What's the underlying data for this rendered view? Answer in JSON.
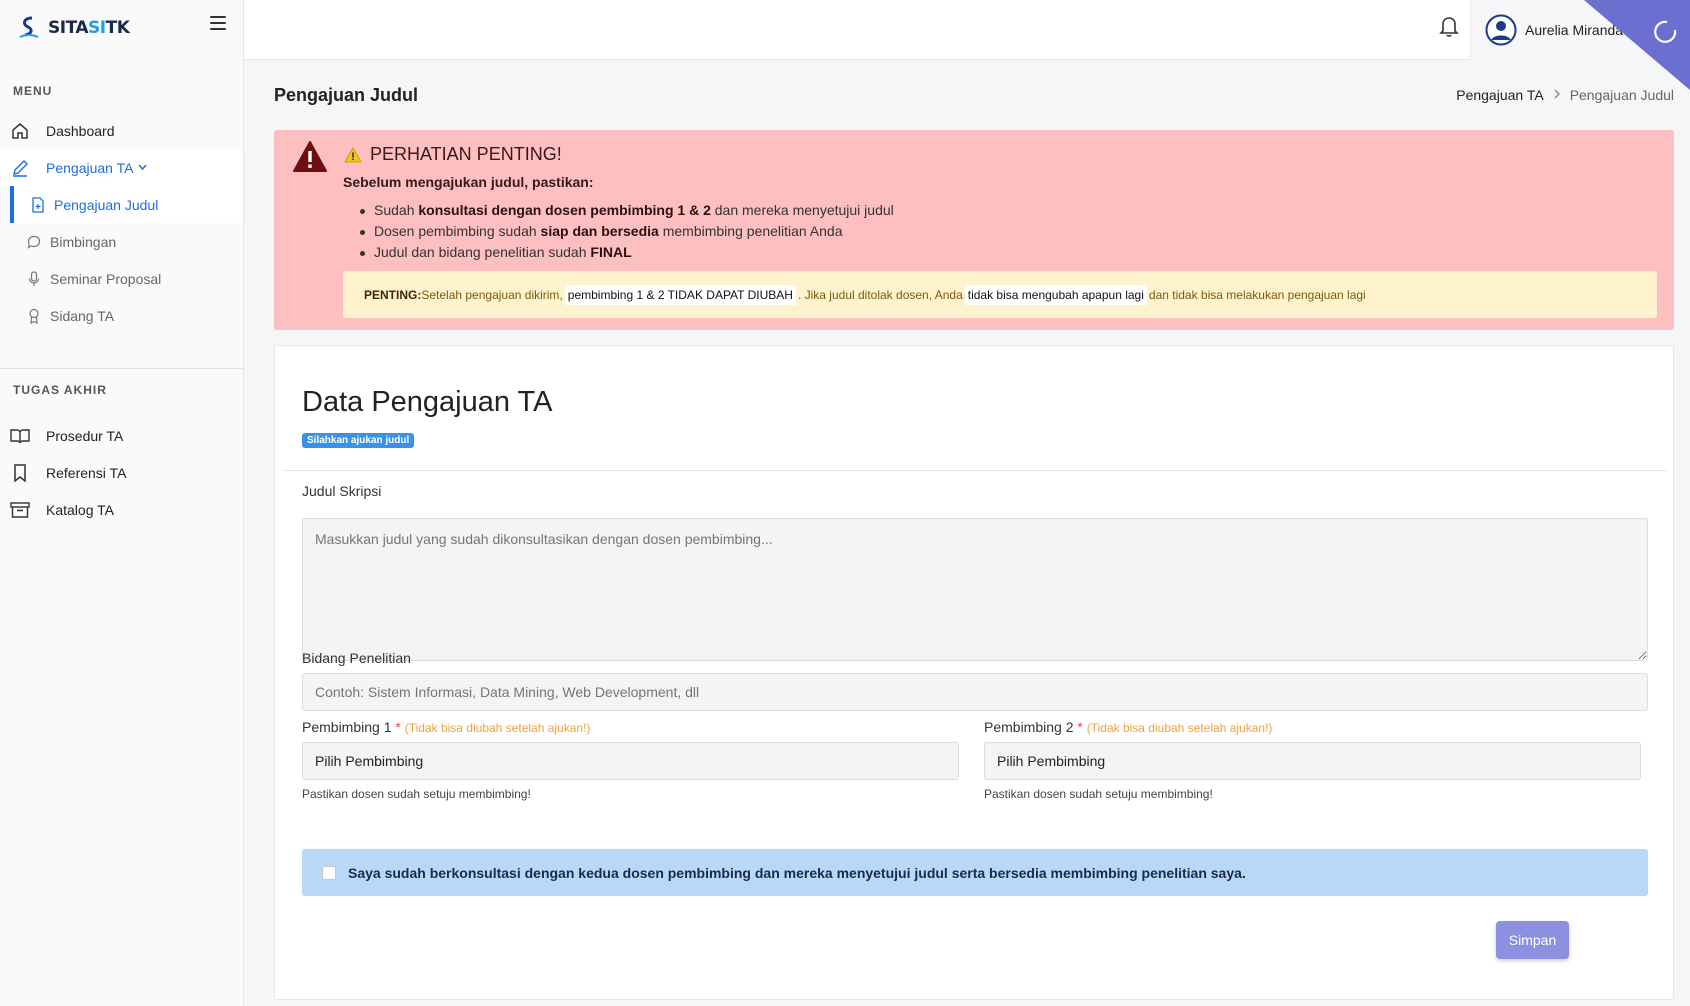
{
  "brand": {
    "logo_text_a": "SI",
    "logo_text_b": "TA",
    "logo_text_c": "SI",
    "logo_text_d": "TK"
  },
  "sidebar": {
    "section_menu": "MENU",
    "dashboard": "Dashboard",
    "pengajuan_ta": "Pengajuan TA",
    "sub": [
      "Pengajuan Judul",
      "Bimbingan",
      "Seminar Proposal",
      "Sidang TA"
    ],
    "section_tugas": "TUGAS AKHIR",
    "tugas_items": [
      "Prosedur TA",
      "Referensi TA",
      "Katalog TA"
    ]
  },
  "topbar": {
    "user_name": "Aurelia Miranda N"
  },
  "page": {
    "title": "Pengajuan Judul",
    "breadcrumb": [
      "Pengajuan TA",
      "Pengajuan Judul"
    ]
  },
  "alert": {
    "title": "PERHATIAN PENTING!",
    "subtitle": "Sebelum mengajukan judul, pastikan:",
    "item1_a": "Sudah ",
    "item1_b": "konsultasi dengan dosen pembimbing 1 & 2",
    "item1_c": " dan mereka menyetujui judul",
    "item2_a": "Dosen pembimbing sudah ",
    "item2_b": "siap dan bersedia",
    "item2_c": " membimbing penelitian Anda",
    "item3_a": "Judul dan bidang penelitian sudah ",
    "item3_b": "FINAL",
    "warn_label": "PENTING:",
    "warn_a": " Setelah pengajuan dikirim, ",
    "warn_hl1": "pembimbing 1 & 2 TIDAK DAPAT DIUBAH",
    "warn_b": ". Jika judul ditolak dosen, Anda ",
    "warn_hl2": "tidak bisa mengubah apapun lagi",
    "warn_c": " dan tidak bisa melakukan pengajuan lagi"
  },
  "form": {
    "card_title": "Data Pengajuan TA",
    "badge": "Silahkan ajukan judul",
    "judul_label": "Judul Skripsi",
    "judul_placeholder": "Masukkan judul yang sudah dikonsultasikan dengan dosen pembimbing...",
    "bidang_label": "Bidang Penelitian",
    "bidang_placeholder": "Contoh: Sistem Informasi, Data Mining, Web Development, dll",
    "p1_label": "Pembimbing 1",
    "p2_label": "Pembimbing 2",
    "required_mark": "*",
    "p_note": "(Tidak bisa diubah setelah ajukan!)",
    "select_default": "Pilih Pembimbing",
    "help_text": "Pastikan dosen sudah setuju membimbing!",
    "confirm_text": "Saya sudah berkonsultasi dengan kedua dosen pembimbing dan mereka menyetujui judul serta bersedia membimbing penelitian saya.",
    "save_label": "Simpan"
  }
}
